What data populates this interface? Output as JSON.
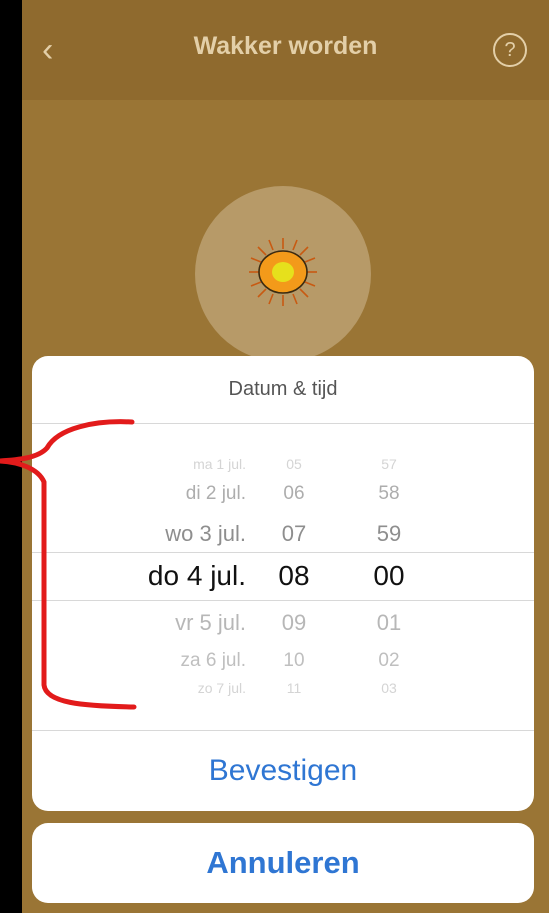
{
  "header": {
    "title": "Wakker worden",
    "help": "?"
  },
  "picker": {
    "title": "Datum & tijd",
    "rows": [
      {
        "date": "ma 1 jul.",
        "hour": "05",
        "minute": "57"
      },
      {
        "date": "di 2 jul.",
        "hour": "06",
        "minute": "58"
      },
      {
        "date": "wo 3 jul.",
        "hour": "07",
        "minute": "59"
      },
      {
        "date": "do 4 jul.",
        "hour": "08",
        "minute": "00"
      },
      {
        "date": "vr 5 jul.",
        "hour": "09",
        "minute": "01"
      },
      {
        "date": "za 6 jul.",
        "hour": "10",
        "minute": "02"
      },
      {
        "date": "zo 7 jul.",
        "hour": "11",
        "minute": "03"
      }
    ],
    "confirm_label": "Bevestigen"
  },
  "cancel_label": "Annuleren",
  "colors": {
    "background": "#9a7535",
    "topbar": "#8f6a2e",
    "accent": "#2f76d3",
    "annotation": "#e21b1b"
  }
}
